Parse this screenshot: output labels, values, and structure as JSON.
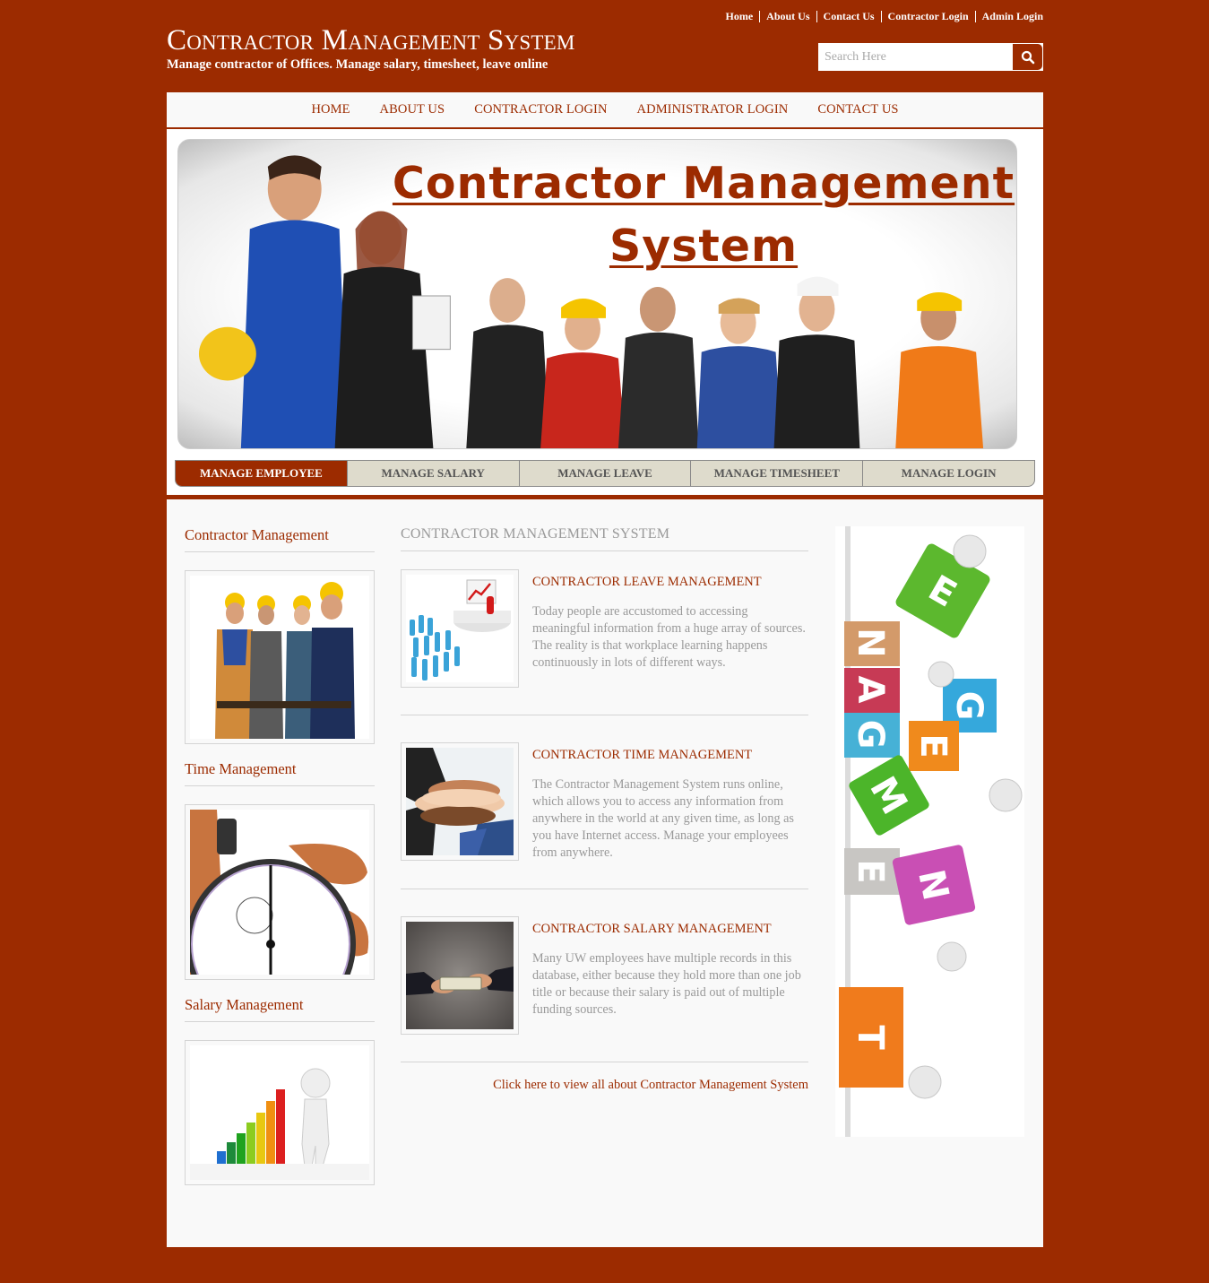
{
  "header": {
    "title": "Contractor Management System",
    "tagline": "Manage contractor of Offices. Manage salary, timesheet, leave online",
    "top_links": [
      "Home",
      "About Us",
      "Contact Us",
      "Contractor Login",
      "Admin Login"
    ],
    "search": {
      "placeholder": "Search Here",
      "value": "",
      "icon": "search-icon"
    }
  },
  "nav": {
    "items": [
      "HOME",
      "ABOUT US",
      "CONTRACTOR LOGIN",
      "ADMINISTRATOR LOGIN",
      "CONTACT US"
    ]
  },
  "banner": {
    "title_line1": "Contractor Management",
    "title_line2": "System",
    "image": "team-of-contractors-photo"
  },
  "tabs": {
    "items": [
      "MANAGE EMPLOYEE",
      "MANAGE SALARY",
      "MANAGE LEAVE",
      "MANAGE TIMESHEET",
      "MANAGE LOGIN"
    ],
    "active": "MANAGE EMPLOYEE"
  },
  "sidebar": {
    "sections": [
      {
        "heading": "Contractor Management",
        "image": "construction-workers-photo"
      },
      {
        "heading": "Time Management",
        "image": "stopwatch-photo"
      },
      {
        "heading": "Salary Management",
        "image": "growth-bar-chart-figure"
      }
    ]
  },
  "main": {
    "heading": "CONTRACTOR MANAGEMENT SYSTEM",
    "items": [
      {
        "title": "CONTRACTOR LEAVE MANAGEMENT",
        "text": "Today people are accustomed to accessing meaningful information from a huge array of sources. The reality is that workplace learning happens continuously in lots of different ways.",
        "image": "presentation-crowd-figure"
      },
      {
        "title": "CONTRACTOR TIME MANAGEMENT",
        "text": "The Contractor Management System runs online, which allows you to access any information from anywhere in the world at any given time, as long as you have Internet access. Manage your employees from anywhere.",
        "image": "team-hands-photo"
      },
      {
        "title": "CONTRACTOR SALARY MANAGEMENT",
        "text": "Many UW employees have multiple records in this database, either because they hold more than one job title or because their salary is paid out of multiple funding sources.",
        "image": "money-handover-photo"
      }
    ],
    "more_link": "Click here to view all about Contractor Management System"
  },
  "right_banner": {
    "image": "management-letter-blocks",
    "letters": [
      "E",
      "N",
      "A",
      "G",
      "G",
      "E",
      "M",
      "E",
      "N",
      "T"
    ]
  },
  "colors": {
    "brand": "#9c2b00",
    "content_bg": "#f9f9f9",
    "tab_bg": "#dedbcc",
    "muted_text": "#999999"
  }
}
